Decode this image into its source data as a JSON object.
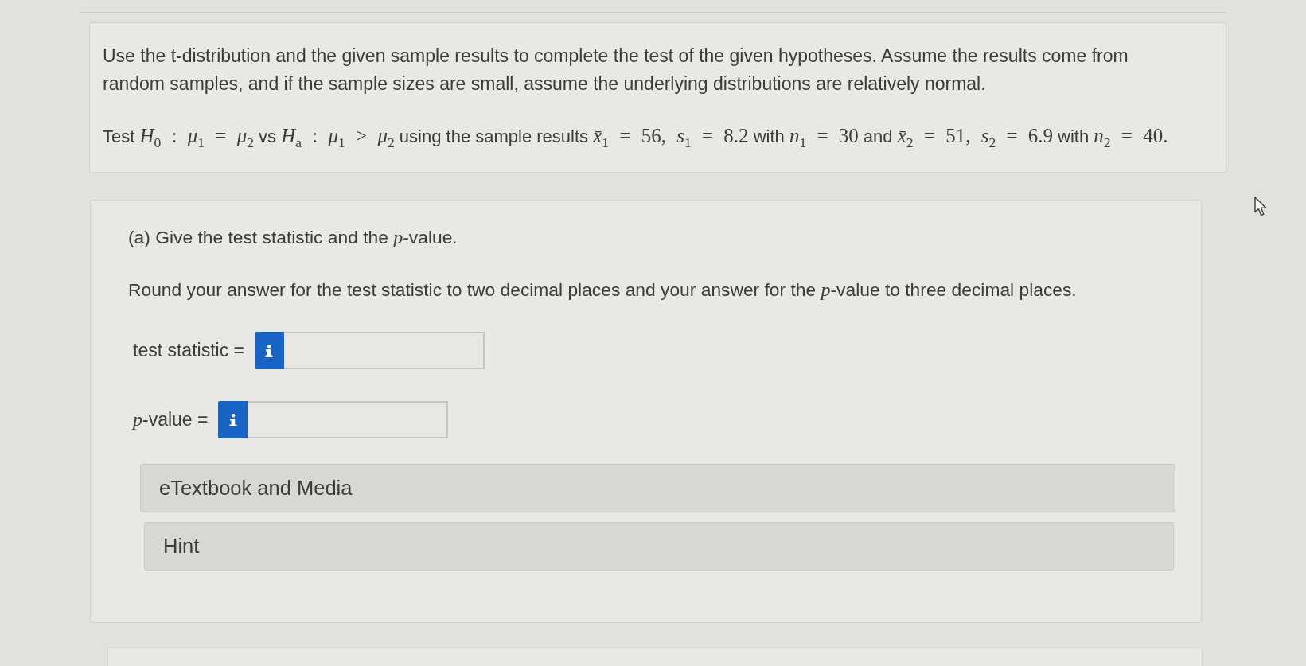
{
  "question": {
    "instructions": "Use the t-distribution and the given sample results to complete the test of the given hypotheses. Assume the results come from random samples, and if the sample sizes are small, assume the underlying distributions are relatively normal.",
    "statement": [
      {
        "kind": "text",
        "text": "Test "
      },
      {
        "kind": "math",
        "text": "*H*$_{0}$ : *μ*$_{1}$ = *μ*$_{2}$"
      },
      {
        "kind": "text",
        "text": " vs "
      },
      {
        "kind": "math",
        "text": "*H*$_{a}$ : *μ*$_{1}$ > *μ*$_{2}$"
      },
      {
        "kind": "text",
        "text": " using the sample results "
      },
      {
        "kind": "math",
        "text": "*x̄*$_{1}$ = 56, *s*$_{1}$ = 8.2"
      },
      {
        "kind": "text",
        "text": " with "
      },
      {
        "kind": "math",
        "text": "*n*$_{1}$ = 30"
      },
      {
        "kind": "text",
        "text": " and "
      },
      {
        "kind": "math",
        "text": "*x̄*$_{2}$ = 51, *s*$_{2}$ = 6.9"
      },
      {
        "kind": "text",
        "text": " with "
      },
      {
        "kind": "math",
        "text": "*n*$_{2}$ = 40."
      }
    ]
  },
  "part": {
    "prompt": "(a) Give the test statistic and the *p*-value.",
    "instructions": "Round your answer for the test statistic to two decimal places and your answer for the *p*-value to three decimal places.",
    "answers": [
      {
        "label": "test statistic ="
      },
      {
        "label": "*p*-value ="
      }
    ],
    "sections": [
      {
        "label": "eTextbook and Media"
      },
      {
        "label": "Hint"
      }
    ]
  }
}
